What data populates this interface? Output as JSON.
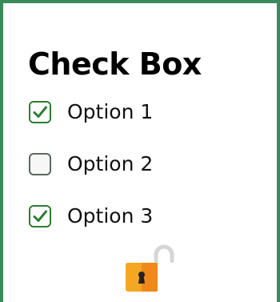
{
  "title": "Check Box",
  "options": [
    {
      "label": "Option 1",
      "checked": true
    },
    {
      "label": "Option 2",
      "checked": false
    },
    {
      "label": "Option 3",
      "checked": true
    }
  ],
  "colors": {
    "frame": "#3a8a5c",
    "checkbox_border": "#2e7d32",
    "checkmark": "#2e7d32",
    "lock_body": "#f5a623"
  },
  "icons": {
    "checkmark": "checkmark-icon",
    "lock": "unlocked-padlock-icon"
  }
}
